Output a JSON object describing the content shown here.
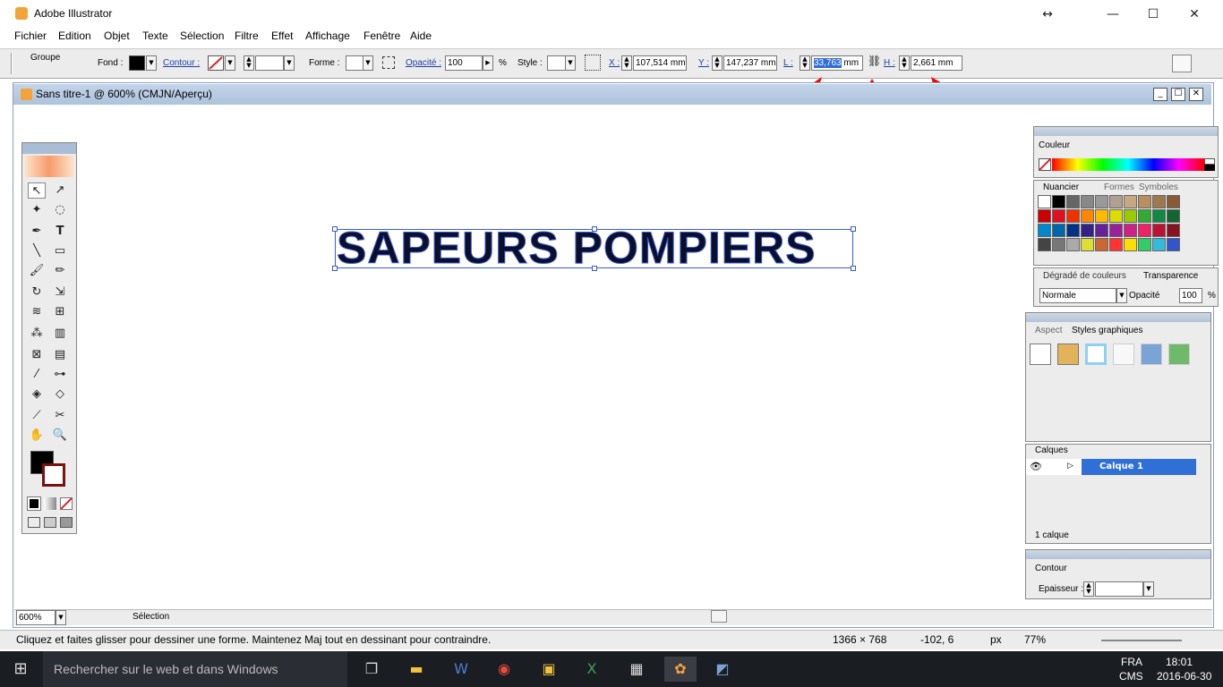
{
  "app": {
    "title": "Adobe Illustrator"
  },
  "window_controls": {
    "restore": "↔",
    "minimize": "—",
    "maximize": "☐",
    "close": "✕"
  },
  "menu": [
    "Fichier",
    "Edition",
    "Objet",
    "Texte",
    "Sélection",
    "Filtre",
    "Effet",
    "Affichage",
    "Fenêtre",
    "Aide"
  ],
  "control": {
    "group": "Groupe",
    "fond": "Fond :",
    "contour": "Contour :",
    "forme": "Forme :",
    "opacite_label": "Opacité :",
    "opacite_value": "100",
    "percent": "%",
    "style": "Style :",
    "x_label": "X :",
    "x_value": "107,514 mm",
    "y_label": "Y :",
    "y_value": "147,237 mm",
    "l_label": "L :",
    "l_value": "33,763",
    "l_unit": "mm",
    "h_label": "H :",
    "h_value": "2,661 mm"
  },
  "document": {
    "title": "Sans titre-1 @ 600% (CMJN/Aperçu)",
    "text": "SAPEURS POMPIERS"
  },
  "bottom": {
    "zoom": "600%",
    "mode": "Sélection"
  },
  "panels": {
    "couleur": "Couleur",
    "nuancier": "Nuancier",
    "formes": "Formes",
    "symboles": "Symboles",
    "degrade": "Dégradé de couleurs",
    "transparence": "Transparence",
    "blend": "Normale",
    "opacite": "Opacité",
    "opacite_val": "100",
    "percent": "%",
    "aspect": "Aspect",
    "styles": "Styles graphiques",
    "calques": "Calques",
    "calque1": "Calque 1",
    "calque_count": "1 calque",
    "contour": "Contour",
    "epaisseur": "Epaisseur :"
  },
  "status": {
    "hint": "Cliquez et faites glisser pour dessiner une forme. Maintenez Maj tout en dessinant pour contraindre.",
    "size": "1366 × 768",
    "coords": "-102, 6",
    "unit": "px",
    "zoom": "77%"
  },
  "taskbar": {
    "search": "Rechercher sur le web et dans Windows",
    "lang": "FRA",
    "lang2": "CMS",
    "time": "18:01",
    "date": "2016-06-30"
  },
  "colors": {
    "annotation_arrow": "#ff0000",
    "selection": "#3a5bd9",
    "highlight": "#2f6fd6"
  }
}
